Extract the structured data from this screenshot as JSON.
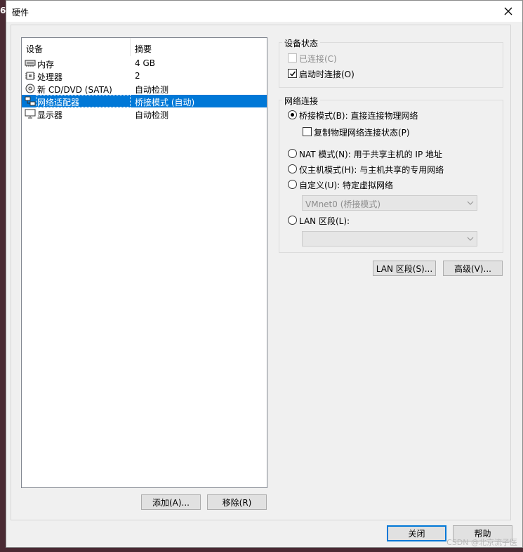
{
  "background": {
    "edge_char": "6"
  },
  "window": {
    "title": "硬件"
  },
  "device_list": {
    "headers": {
      "device": "设备",
      "summary": "摘要"
    },
    "rows": [
      {
        "icon": "memory-icon",
        "name": "内存",
        "summary": "4 GB"
      },
      {
        "icon": "processor-icon",
        "name": "处理器",
        "summary": "2"
      },
      {
        "icon": "cd-dvd-icon",
        "name": "新 CD/DVD (SATA)",
        "summary": "自动检测"
      },
      {
        "icon": "network-adapter-icon",
        "name": "网络适配器",
        "summary": "桥接模式 (自动)",
        "selected": true
      },
      {
        "icon": "display-icon",
        "name": "显示器",
        "summary": "自动检测"
      }
    ]
  },
  "buttons": {
    "add": "添加(A)...",
    "remove": "移除(R)",
    "lan_segments": "LAN 区段(S)...",
    "advanced": "高级(V)...",
    "close": "关闭",
    "help": "帮助"
  },
  "device_status": {
    "title": "设备状态",
    "connected": {
      "label": "已连接(C)",
      "checked": false,
      "disabled": true
    },
    "connect_at_power_on": {
      "label": "启动时连接(O)",
      "checked": true
    }
  },
  "network_connection": {
    "title": "网络连接",
    "bridged": {
      "label": "桥接模式(B): 直接连接物理网络",
      "selected": true
    },
    "replicate_state": {
      "label": "复制物理网络连接状态(P)",
      "checked": false
    },
    "nat": {
      "label": "NAT 模式(N): 用于共享主机的 IP 地址"
    },
    "host_only": {
      "label": "仅主机模式(H): 与主机共享的专用网络"
    },
    "custom": {
      "label": "自定义(U): 特定虚拟网络"
    },
    "custom_network_value": "VMnet0 (桥接模式)",
    "lan_segment": {
      "label": "LAN 区段(L):"
    },
    "lan_segment_value": ""
  },
  "watermark": "CSDN @北京流子医"
}
